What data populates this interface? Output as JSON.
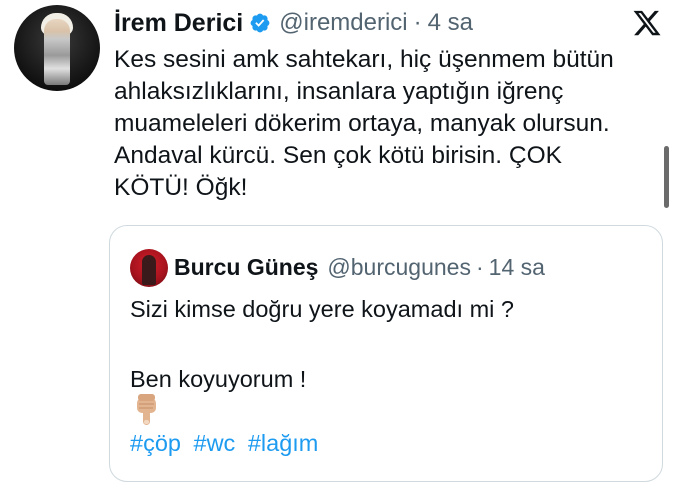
{
  "tweet": {
    "display_name": "İrem Derici",
    "handle": "@iremderici",
    "separator": "·",
    "time": "4 sa",
    "text_lines": [
      "Kes sesini amk sahtekarı, hiç üşenmem bütün",
      "ahlaksızlıklarını, insanlara yaptığın iğrenç",
      "muameleleri dökerim ortaya, manyak olursun.",
      "Andaval kürcü. Sen çok kötü birisin. ÇOK",
      "KÖTÜ! Öğk!"
    ],
    "verified_icon": "verified-badge-icon",
    "brand_icon": "x-logo-icon",
    "colors": {
      "verified": "#1d9bf0",
      "secondary_text": "#536471",
      "hashtag": "#1d9bf0",
      "border": "#cfd9de"
    }
  },
  "quote": {
    "display_name": "Burcu Güneş",
    "handle": "@burcugunes",
    "separator": "·",
    "time": "14 sa",
    "line1": "Sizi kimse doğru yere koyamadı mi ?",
    "line2": "Ben koyuyorum !",
    "emoji_icon": "pointing-down-hand-icon",
    "hashtags": [
      "#çöp",
      "#wc",
      "#lağım"
    ]
  }
}
